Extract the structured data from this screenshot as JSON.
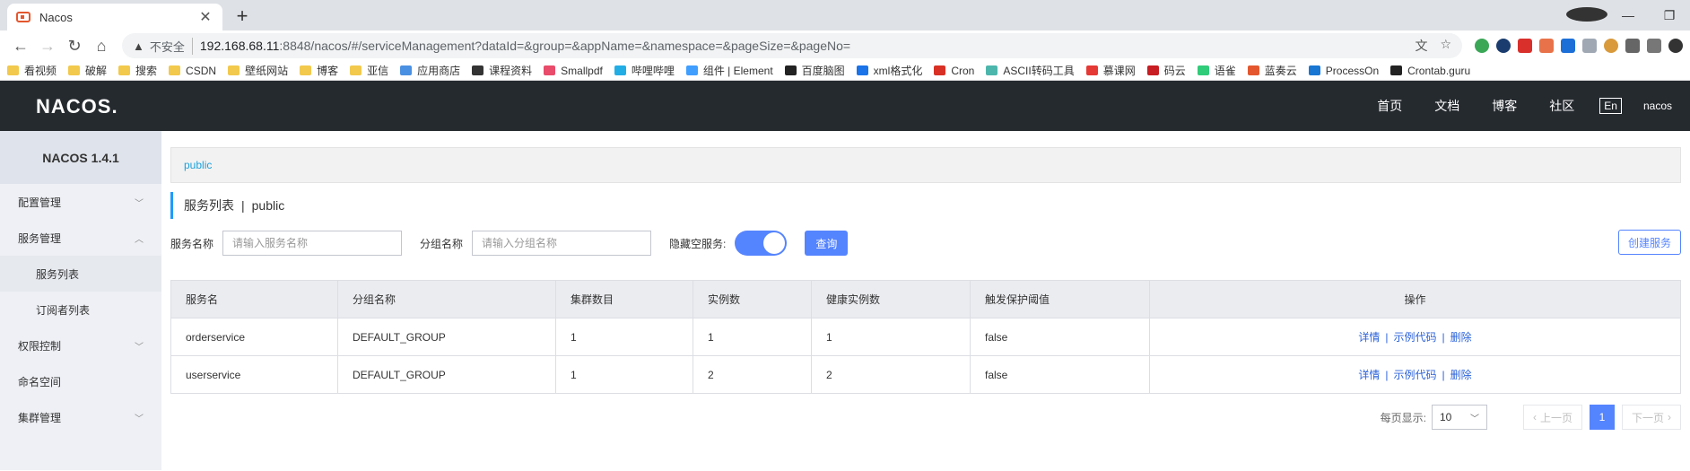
{
  "browser": {
    "tab_title": "Nacos",
    "new_tab": "+",
    "omnibox": {
      "insecure_label": "不安全",
      "url_host": "192.168.68.11",
      "url_rest": ":8848/nacos/#/serviceManagement?dataId=&group=&appName=&namespace=&pageSize=&pageNo="
    },
    "bookmarks": [
      {
        "label": "看视频",
        "icon": "folder-icon"
      },
      {
        "label": "破解",
        "icon": "folder-icon"
      },
      {
        "label": "搜索",
        "icon": "folder-icon"
      },
      {
        "label": "CSDN",
        "icon": "folder-icon"
      },
      {
        "label": "壁纸网站",
        "icon": "folder-icon"
      },
      {
        "label": "博客",
        "icon": "folder-icon"
      },
      {
        "label": "亚信",
        "icon": "folder-icon"
      },
      {
        "label": "应用商店",
        "icon": "store-icon"
      },
      {
        "label": "课程资料",
        "icon": "github-icon"
      },
      {
        "label": "Smallpdf",
        "icon": "smallpdf-icon"
      },
      {
        "label": "哔哩哔哩",
        "icon": "bilibili-icon"
      },
      {
        "label": "组件 | Element",
        "icon": "element-icon"
      },
      {
        "label": "百度脑图",
        "icon": "baidu-naotu-icon"
      },
      {
        "label": "xml格式化",
        "icon": "xml-icon"
      },
      {
        "label": "Cron",
        "icon": "cron-icon"
      },
      {
        "label": "ASCII转码工具",
        "icon": "ascii-icon"
      },
      {
        "label": "慕课网",
        "icon": "imooc-icon"
      },
      {
        "label": "码云",
        "icon": "gitee-icon"
      },
      {
        "label": "语雀",
        "icon": "yuque-icon"
      },
      {
        "label": "蓝奏云",
        "icon": "lanzou-icon"
      },
      {
        "label": "ProcessOn",
        "icon": "processon-icon"
      },
      {
        "label": "Crontab.guru",
        "icon": "crontab-icon"
      }
    ]
  },
  "header": {
    "logo": "NACOS.",
    "nav": [
      "首页",
      "文档",
      "博客",
      "社区"
    ],
    "lang": "En",
    "user": "nacos"
  },
  "sidebar": {
    "title": "NACOS 1.4.1",
    "items": [
      {
        "label": "配置管理",
        "chevron": "chevron-down-icon"
      },
      {
        "label": "服务管理",
        "chevron": "chevron-up-icon"
      },
      {
        "label": "服务列表"
      },
      {
        "label": "订阅者列表"
      },
      {
        "label": "权限控制",
        "chevron": "chevron-down-icon"
      },
      {
        "label": "命名空间"
      },
      {
        "label": "集群管理",
        "chevron": "chevron-down-icon"
      }
    ]
  },
  "main": {
    "namespace": "public",
    "heading": {
      "title": "服务列表",
      "sep": "|",
      "namespace": "public"
    },
    "filters": {
      "service_label": "服务名称",
      "service_placeholder": "请输入服务名称",
      "group_label": "分组名称",
      "group_placeholder": "请输入分组名称",
      "hide_empty_label": "隐藏空服务:",
      "hide_empty_on": true,
      "query_button": "查询",
      "create_button": "创建服务"
    },
    "table": {
      "headers": [
        "服务名",
        "分组名称",
        "集群数目",
        "实例数",
        "健康实例数",
        "触发保护阈值",
        "操作"
      ],
      "rows": [
        {
          "name": "orderservice",
          "group": "DEFAULT_GROUP",
          "clusters": "1",
          "instances": "1",
          "healthy": "1",
          "threshold": "false"
        },
        {
          "name": "userservice",
          "group": "DEFAULT_GROUP",
          "clusters": "1",
          "instances": "2",
          "healthy": "2",
          "threshold": "false"
        }
      ],
      "ops": {
        "detail": "详情",
        "sample": "示例代码",
        "delete": "删除",
        "sep": "|"
      }
    },
    "pagination": {
      "page_size_label": "每页显示:",
      "page_size": "10",
      "prev": "上一页",
      "current": "1",
      "next": "下一页"
    }
  },
  "colors": {
    "primary": "#5584ff",
    "header_bg": "#252a2f",
    "sidebar_bg": "#eef0f5",
    "link": "#2b62d9"
  }
}
